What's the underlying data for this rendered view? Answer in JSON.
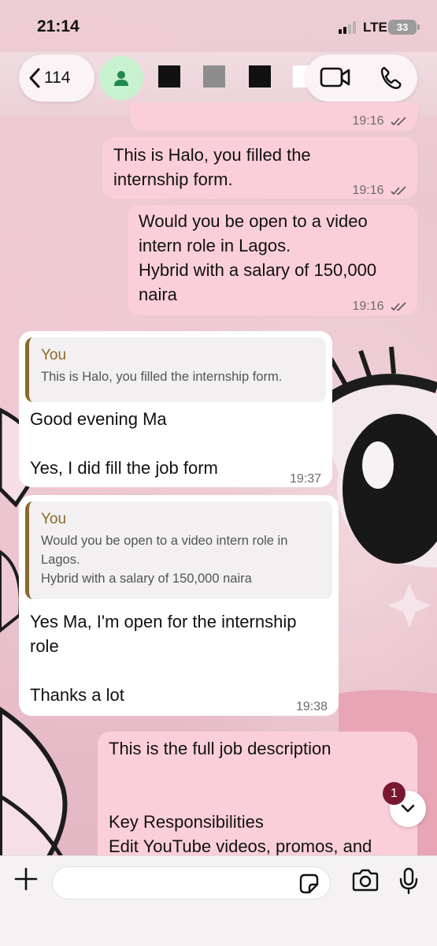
{
  "status_bar": {
    "time": "21:14",
    "network": "LTE",
    "battery": "33"
  },
  "header": {
    "back_count": "114"
  },
  "messages": [
    {
      "time": "19:16"
    },
    {
      "text": "This is Halo, you filled the\ninternship form.",
      "time": "19:16"
    },
    {
      "text": "Would you be open to a video\nintern role in Lagos.\nHybrid with a salary of 150,000\nnaira",
      "time": "19:16"
    },
    {
      "quote_author": "You",
      "quote_text": "This is Halo, you filled the internship form.",
      "text": "Good evening Ma\n\nYes, I did fill the job form",
      "time": "19:37"
    },
    {
      "quote_author": "You",
      "quote_text": "Would you be open to a video intern role in\nLagos.\nHybrid with a salary of 150,000 naira",
      "text": "Yes Ma, I'm open for the internship\nrole\n\nThanks a lot",
      "time": "19:38"
    },
    {
      "text": "This is the full job description\n\n\nKey Responsibilities\nEdit YouTube videos, promos, and"
    }
  ],
  "unread_count": "1",
  "colors": {
    "outgoing": "#fbcfd9",
    "incoming": "#ffffff",
    "quote_bar": "#8a6a2e",
    "avatar_bg": "#c8f1cf",
    "badge": "#7a1631"
  },
  "icons": [
    "back-chevron-icon",
    "contact-person-icon",
    "video-call-icon",
    "phone-icon",
    "plus-icon",
    "sticker-icon",
    "camera-icon",
    "microphone-icon",
    "chevron-down-icon",
    "read-ticks-icon"
  ]
}
